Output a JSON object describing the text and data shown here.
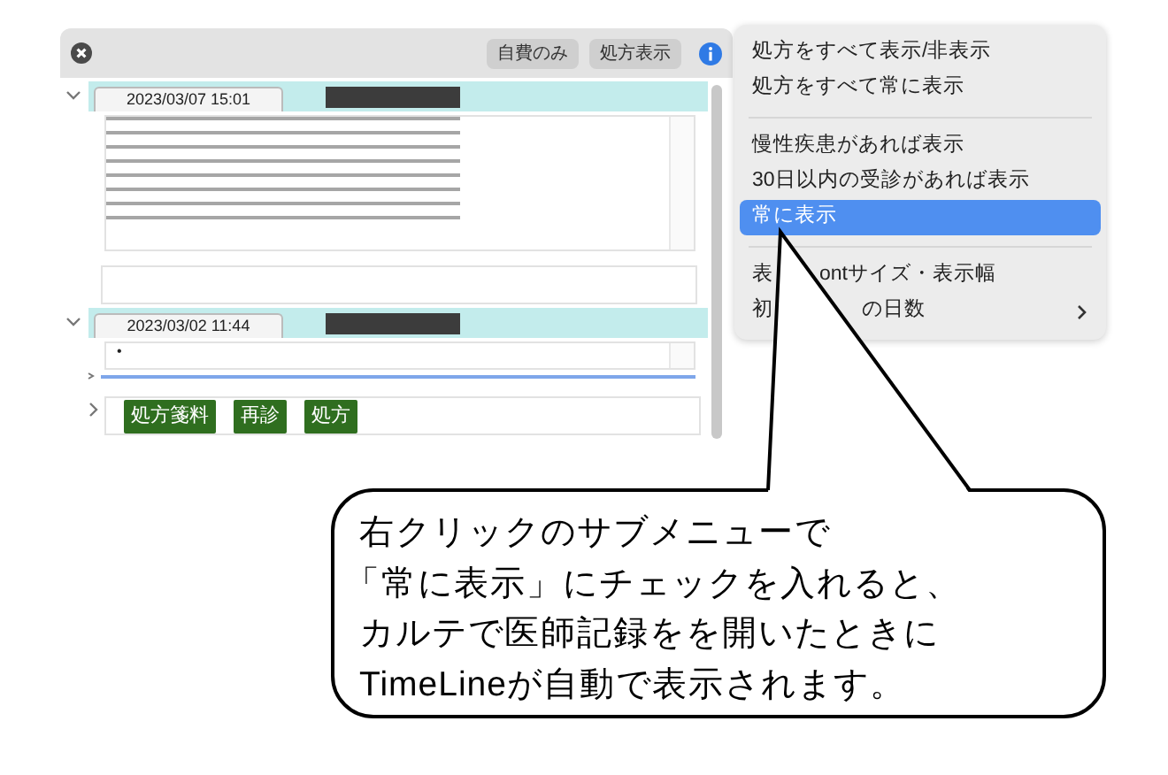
{
  "toolbar": {
    "buttons": [
      {
        "label": "自費のみ"
      },
      {
        "label": "処方表示"
      }
    ]
  },
  "entries": [
    {
      "timestamp": "2023/03/07 15:01",
      "expanded": true,
      "kind": "notes"
    },
    {
      "timestamp": "2023/03/02 11:44",
      "expanded": true,
      "kind": "bullet",
      "bullet": "•",
      "badges": [
        {
          "label": "処方箋料"
        },
        {
          "label": "再診"
        },
        {
          "label": "処方"
        }
      ]
    }
  ],
  "context_menu": {
    "groups": [
      [
        {
          "label": "処方をすべて表示/非表示",
          "selected": false
        },
        {
          "label": "処方をすべて常に表示",
          "selected": false
        }
      ],
      [
        {
          "label": "慢性疾患があれば表示",
          "selected": false
        },
        {
          "label": "30日以内の受診があれば表示",
          "selected": false
        },
        {
          "label": "常に表示",
          "selected": true
        }
      ],
      [
        {
          "label_start": "表",
          "label_end": "ontサイズ・表示幅",
          "selected": false
        },
        {
          "label_start": "初",
          "label_end": "の日数",
          "selected": false,
          "submenu": true
        }
      ]
    ]
  },
  "callout": {
    "lines": [
      "右クリックのサブメニューで",
      "「常に表示」にチェックを入れると、",
      "カルテで医師記録をを開いたときに",
      "TimeLineが自動で表示されます。"
    ]
  }
}
